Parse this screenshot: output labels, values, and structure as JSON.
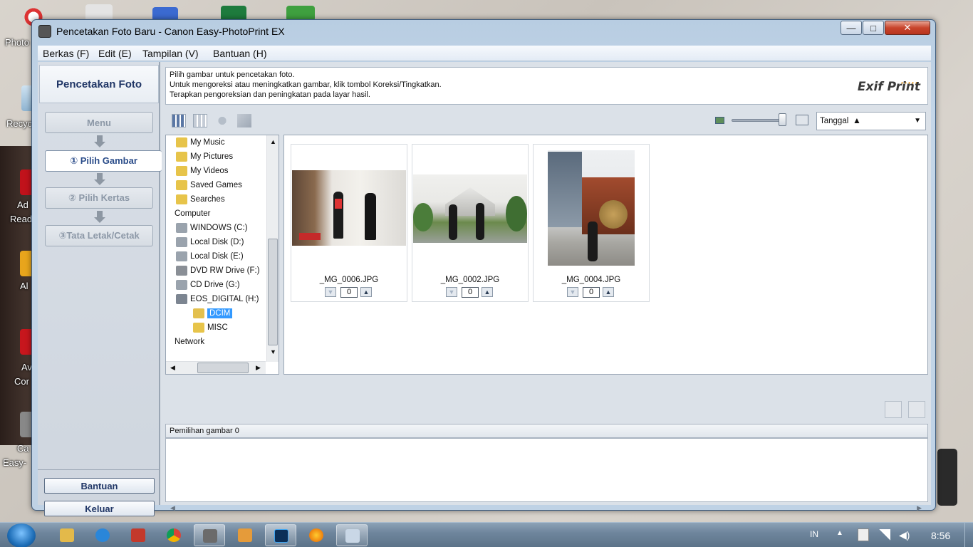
{
  "desktop": {
    "labels": [
      "Photo",
      "Recyc",
      "Ad",
      "Read",
      "Al",
      "Av",
      "Cor",
      "Ca",
      "Easy-"
    ]
  },
  "window": {
    "title": "Pencetakan Foto Baru - Canon Easy-PhotoPrint EX",
    "controls": {
      "minimize": "—",
      "maximize": "□",
      "close": "✕"
    }
  },
  "menu": [
    "Berkas (F)",
    "Edit (E)",
    "Tampilan (V)",
    "Bantuan (H)"
  ],
  "left_panel": {
    "header": "Pencetakan Foto",
    "steps": [
      {
        "label": "Menu",
        "active": false
      },
      {
        "label": "①  Pilih Gambar",
        "active": true
      },
      {
        "label": "②  Pilih Kertas",
        "active": false
      },
      {
        "label": "③Tata Letak/Cetak",
        "active": false
      }
    ],
    "help_button": "Bantuan",
    "exit_button": "Keluar"
  },
  "info": {
    "lines": [
      "Pilih gambar untuk pencetakan foto.",
      "Untuk mengoreksi atau meningkatkan gambar, klik tombol Koreksi/Tingkatkan.",
      "Terapkan pengoreksian dan peningkatan pada layar hasil."
    ],
    "logo": "Exif Print"
  },
  "toolbar": {
    "sort_label": "Tanggal",
    "sort_direction": "▲",
    "zoom_level": 0.95
  },
  "tree": [
    {
      "label": "My Music",
      "indent": 1,
      "icon": "music-folder-icon"
    },
    {
      "label": "My Pictures",
      "indent": 1,
      "icon": "pictures-folder-icon"
    },
    {
      "label": "My Videos",
      "indent": 1,
      "icon": "videos-folder-icon"
    },
    {
      "label": "Saved Games",
      "indent": 1,
      "icon": "games-folder-icon"
    },
    {
      "label": "Searches",
      "indent": 1,
      "icon": "search-folder-icon"
    },
    {
      "label": "Computer",
      "indent": 0,
      "icon": "computer-icon"
    },
    {
      "label": "WINDOWS (C:)",
      "indent": 1,
      "icon": "drive-icon"
    },
    {
      "label": "Local Disk (D:)",
      "indent": 1,
      "icon": "drive-icon"
    },
    {
      "label": "Local Disk (E:)",
      "indent": 1,
      "icon": "drive-icon"
    },
    {
      "label": "DVD RW Drive (F:)",
      "indent": 1,
      "icon": "dvd-drive-icon"
    },
    {
      "label": "CD Drive (G:)",
      "indent": 1,
      "icon": "cd-drive-icon"
    },
    {
      "label": "EOS_DIGITAL (H:)",
      "indent": 1,
      "icon": "removable-drive-icon"
    },
    {
      "label": "DCIM",
      "indent": 2,
      "icon": "camera-folder-icon",
      "selected": true
    },
    {
      "label": "MISC",
      "indent": 2,
      "icon": "folder-icon"
    },
    {
      "label": "Network",
      "indent": 0,
      "icon": "network-icon"
    }
  ],
  "photos": [
    {
      "name": "_MG_0006.JPG",
      "count": "0"
    },
    {
      "name": "_MG_0002.JPG",
      "count": "0"
    },
    {
      "name": "_MG_0004.JPG",
      "count": "0"
    }
  ],
  "selection": {
    "label": "Pemilihan gambar 0"
  },
  "taskbar": {
    "lang": "IN",
    "time": "8:56",
    "apps": [
      "explorer-icon",
      "ie-icon",
      "canon-icon",
      "chrome-icon",
      "photoprint-icon",
      "media-icon",
      "photoshop-icon",
      "firefox-icon",
      "paint-icon"
    ]
  }
}
